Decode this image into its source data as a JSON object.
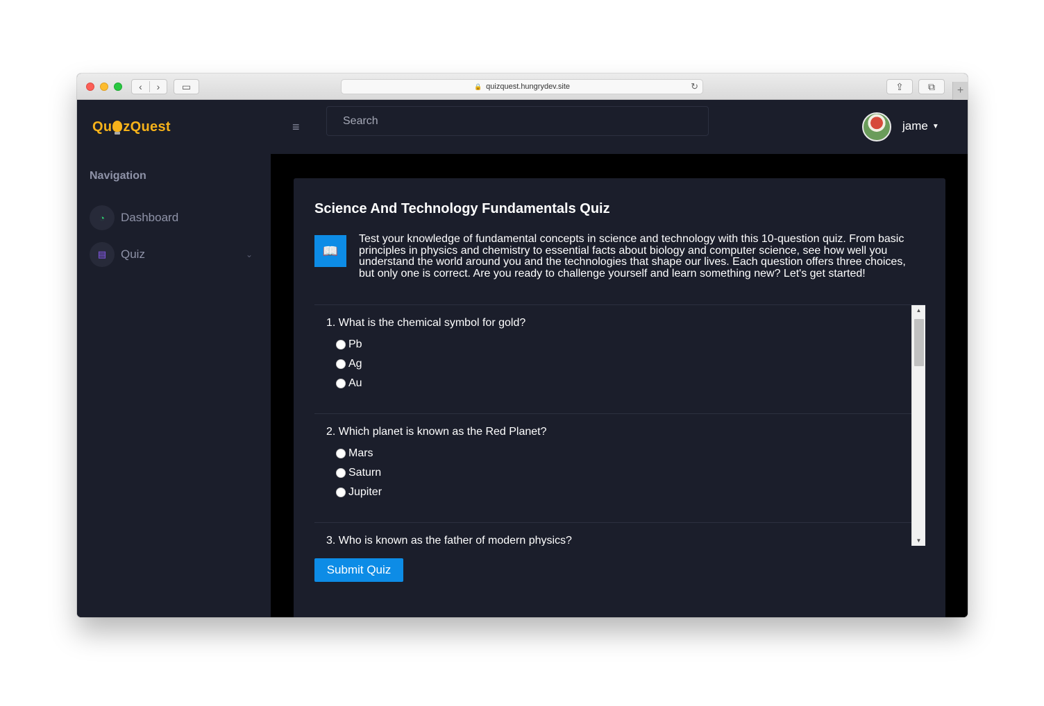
{
  "browser": {
    "url": "quizquest.hungrydev.site"
  },
  "header": {
    "logo_left": "Qu",
    "logo_right": "zQuest",
    "search_placeholder": "Search",
    "username": "jame"
  },
  "sidebar": {
    "title": "Navigation",
    "items": [
      {
        "label": "Dashboard",
        "icon": "gauge-icon",
        "color": "#2ecc71"
      },
      {
        "label": "Quiz",
        "icon": "list-icon",
        "color": "#8c5cf6"
      }
    ]
  },
  "quiz": {
    "title": "Science And Technology Fundamentals Quiz",
    "description": "Test your knowledge of fundamental concepts in science and technology with this 10-question quiz. From basic principles in physics and chemistry to essential facts about biology and computer science, see how well you understand the world around you and the technologies that shape our lives. Each question offers three choices, but only one is correct. Are you ready to challenge yourself and learn something new? Let's get started!",
    "questions": [
      {
        "text": "1. What is the chemical symbol for gold?",
        "options": [
          "Pb",
          "Ag",
          "Au"
        ]
      },
      {
        "text": "2. Which planet is known as the Red Planet?",
        "options": [
          "Mars",
          "Saturn",
          "Jupiter"
        ]
      },
      {
        "text": "3. Who is known as the father of modern physics?",
        "options": []
      }
    ],
    "submit_label": "Submit Quiz"
  },
  "colors": {
    "accent": "#0d8ce6",
    "logo": "#f6b21a",
    "background": "#1b1e2b"
  }
}
